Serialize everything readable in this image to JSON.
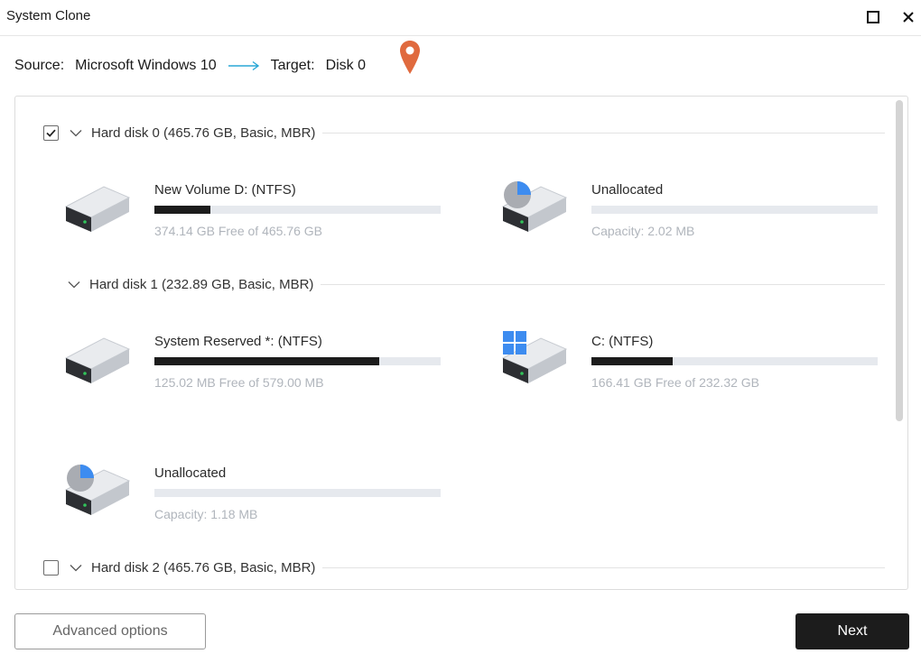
{
  "window": {
    "title": "System Clone",
    "maximize_icon": "maximize-icon",
    "close_icon": "close-icon"
  },
  "source_target": {
    "source_label": "Source:",
    "source_value": "Microsoft Windows 10",
    "target_label": "Target:",
    "target_value": "Disk 0",
    "arrow_icon": "arrow-right-icon",
    "pin_icon": "location-pin-icon",
    "arrow_color": "#2aa7d6",
    "pin_color": "#e06a3e"
  },
  "disks": [
    {
      "label": "Hard disk 0 (465.76 GB, Basic, MBR)",
      "checked": true,
      "partitions": [
        {
          "name": "New Volume D: (NTFS)",
          "info": "374.14 GB Free of 465.76 GB",
          "used_fraction": 0.197,
          "icon": "drive-icon"
        },
        {
          "name": "Unallocated",
          "info": "Capacity: 2.02 MB",
          "used_fraction": 0,
          "icon": "unallocated-drive-icon"
        }
      ]
    },
    {
      "label": "Hard disk 1 (232.89 GB, Basic, MBR)",
      "partitions": [
        {
          "name": "System Reserved *: (NTFS)",
          "info": "125.02 MB Free of 579.00 MB",
          "used_fraction": 0.784,
          "icon": "drive-icon"
        },
        {
          "name": "C: (NTFS)",
          "info": "166.41 GB Free of 232.32 GB",
          "used_fraction": 0.284,
          "icon": "windows-drive-icon"
        },
        {
          "name": "Unallocated",
          "info": "Capacity: 1.18 MB",
          "used_fraction": 0,
          "icon": "unallocated-drive-icon"
        }
      ]
    },
    {
      "label": "Hard disk 2 (465.76 GB, Basic, MBR)",
      "checked": false
    }
  ],
  "footer": {
    "advanced_label": "Advanced options",
    "next_label": "Next"
  },
  "colors": {
    "accent_blue": "#3d8cf0",
    "bar_fill": "#1c1c1c",
    "bar_track": "#e6e9ee",
    "next_button_bg": "#1c1c1c"
  }
}
